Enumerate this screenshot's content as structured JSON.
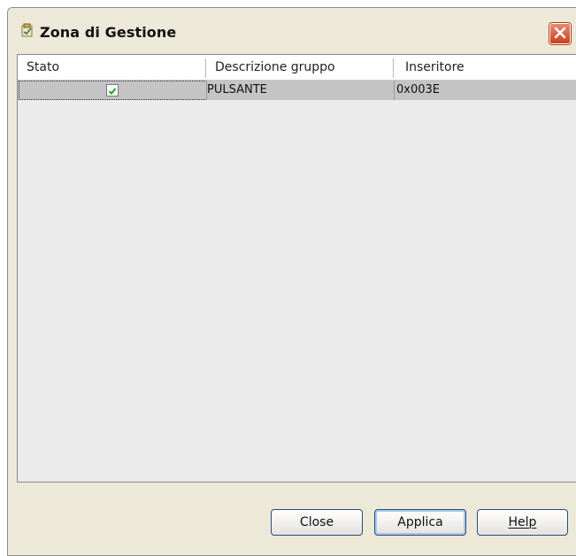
{
  "window": {
    "title": "Zona di Gestione",
    "title_icon": "window-app-icon",
    "close_icon": "close-icon"
  },
  "table": {
    "columns": [
      "Stato",
      "Descrizione gruppo",
      "Inseritore"
    ],
    "rows": [
      {
        "stato_checked": true,
        "descrizione": "PULSANTE",
        "inseritore": "0x003E"
      }
    ]
  },
  "buttons": {
    "close": "Close",
    "applica": "Applica",
    "help": "Help"
  },
  "colors": {
    "dialog_bg": "#ece9d8",
    "selected_row": "#c4c4c4",
    "close_button": "#c8401f",
    "checkmark": "#21a121"
  }
}
